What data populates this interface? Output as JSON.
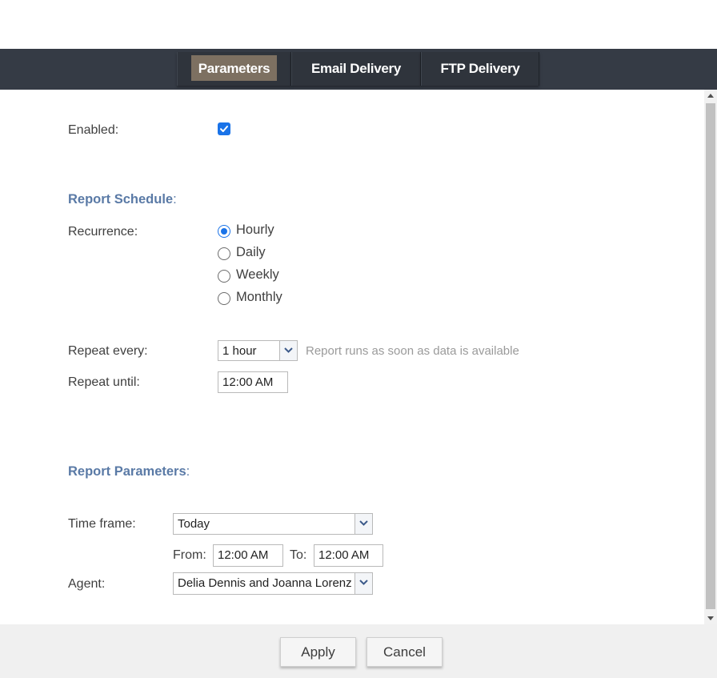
{
  "tabs": {
    "parameters": "Parameters",
    "email_delivery": "Email Delivery",
    "ftp_delivery": "FTP Delivery",
    "active": "Parameters"
  },
  "form": {
    "enabled_label": "Enabled:",
    "enabled_checked": true,
    "report_schedule": {
      "title": "Report Schedule",
      "colon": ":",
      "recurrence_label": "Recurrence:",
      "recurrence_options": [
        "Hourly",
        "Daily",
        "Weekly",
        "Monthly"
      ],
      "recurrence_selected": "Hourly",
      "repeat_every_label": "Repeat every:",
      "repeat_every_value": "1 hour",
      "repeat_every_hint": "Report runs as soon as data is available",
      "repeat_until_label": "Repeat until:",
      "repeat_until_value": "12:00 AM"
    },
    "report_parameters": {
      "title": "Report Parameters",
      "colon": ":",
      "time_frame_label": "Time frame:",
      "time_frame_value": "Today",
      "from_label": "From:",
      "from_value": "12:00 AM",
      "to_label": "To:",
      "to_value": "12:00 AM",
      "agent_label": "Agent:",
      "agent_value": "Delia Dennis and Joanna Lorenz"
    }
  },
  "footer": {
    "apply": "Apply",
    "cancel": "Cancel"
  },
  "colors": {
    "tabbar": "#353b45",
    "active_tab": "#7d7061",
    "section_title": "#5a7aa6",
    "accent": "#1a73e8"
  },
  "icons": {
    "checkbox": "checkmark-icon",
    "dropdown": "chevron-down-icon"
  }
}
